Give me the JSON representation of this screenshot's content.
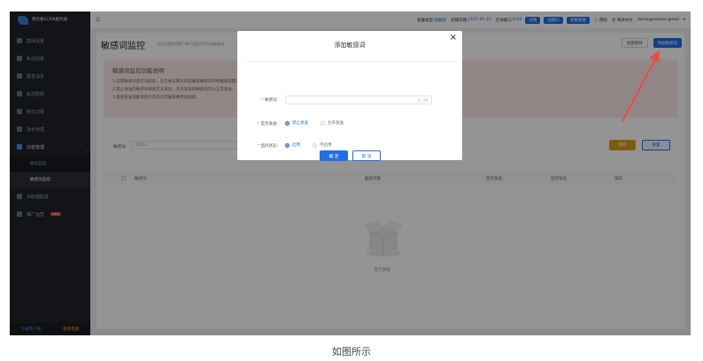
{
  "app": {
    "logo_text": "我有看SCRM服务器"
  },
  "sidebar": {
    "items": [
      {
        "label": "基础设置"
      },
      {
        "label": "私信回复"
      },
      {
        "label": "群发消息"
      },
      {
        "label": "私信群组"
      },
      {
        "label": "购买记录"
      },
      {
        "label": "流水管理"
      },
      {
        "label": "内容管理"
      }
    ],
    "sub_items": [
      {
        "label": "聊天监控"
      },
      {
        "label": "敏感词监控"
      }
    ],
    "items_after": [
      {
        "label": "AI助理配置"
      },
      {
        "label": "推广运营",
        "badge": "HOT"
      }
    ],
    "footer": {
      "download": "下载客户端",
      "contact": "联系客服"
    }
  },
  "header": {
    "menu_toggle": "☰",
    "package_label": "套餐类型:",
    "package_value": "旗舰版",
    "expire_label": "到期日期:",
    "expire_value": "2025-05-16",
    "accounts_label": "在线端口:",
    "accounts_value": "0/30",
    "renew_btn": "续费",
    "add_port_btn": "加端口",
    "upgrade_btn": "更换套餐",
    "help": "帮助",
    "language": "简体中文",
    "user": "dxrxx@xxxxxx.gmail"
  },
  "page": {
    "title": "敏感词监控",
    "desc": "在此设置监控客户聊天内容是否包含敏感词",
    "batch_delete_btn": "批量删除",
    "add_word_btn": "添加敏感词"
  },
  "notice": {
    "title": "敏感词监控功能说明",
    "lines": [
      "1.启用敏感词监控功能后，社交账号聊天内容触发敏感词时将推送提醒。",
      "2.禁止发送的敏感词将会无法发出，允许发送的敏感词可以正常发送。",
      "3.直接发送或翻译后的内容均可触发敏感词规则。"
    ]
  },
  "filter": {
    "label": "敏感词:",
    "placeholder": "请输入",
    "search_btn": "搜索",
    "reset_btn": "重置"
  },
  "table": {
    "columns": [
      "敏感词",
      "触发次数",
      "是否发送",
      "监控状态",
      "操作"
    ],
    "empty_text": "暂无数据"
  },
  "modal": {
    "title": "添加敏感词",
    "close": "×",
    "word_label": "敏感词:",
    "word_counter": "0 / 20",
    "send_label": "是否发送:",
    "send_options": [
      "禁止发送",
      "允许发送"
    ],
    "status_label": "监控状态:",
    "status_options": [
      "启用",
      "不启用"
    ],
    "confirm_btn": "确 定",
    "cancel_btn": "取 消"
  },
  "caption": "如图所示",
  "colors": {
    "primary": "#1f6fe8",
    "sidebar": "#1f2329",
    "warning": "#d4a017",
    "arrow": "#f04848"
  }
}
